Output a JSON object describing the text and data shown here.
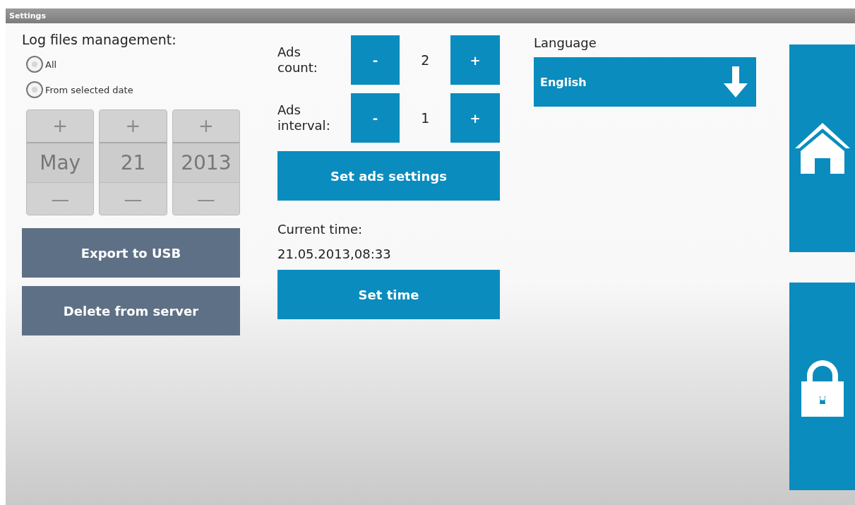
{
  "window": {
    "title": "Settings"
  },
  "log_files": {
    "title": "Log files management:",
    "options": [
      {
        "label": "All",
        "selected": false
      },
      {
        "label": "From selected date",
        "selected": false
      }
    ],
    "date_pickers": [
      {
        "plus": "+",
        "value": "May",
        "minus": "—"
      },
      {
        "plus": "+",
        "value": "21",
        "minus": "—"
      },
      {
        "plus": "+",
        "value": "2013",
        "minus": "—"
      }
    ],
    "buttons": [
      "Export to USB",
      "Delete from server"
    ]
  },
  "ads": {
    "steppers": [
      {
        "label": "Ads\ncount:",
        "minus": "-",
        "value": "2",
        "plus": "+"
      },
      {
        "label": "Ads\ninterval:",
        "minus": "-",
        "value": "1",
        "plus": "+"
      }
    ],
    "button": "Set ads settings"
  },
  "time": {
    "label": "Current time:",
    "value": "21.05.2013,08:33",
    "button": "Set time"
  },
  "language": {
    "label": "Language",
    "value": "English"
  },
  "side_tiles": [
    {
      "kind": "home"
    },
    {
      "kind": "lock"
    }
  ]
}
